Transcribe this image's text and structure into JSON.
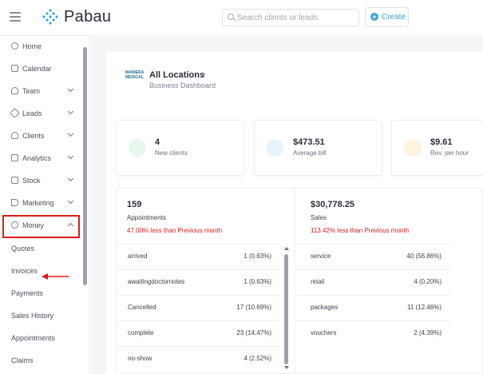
{
  "header": {
    "logo_text": "Pabau",
    "search_placeholder": "Search clients or leads",
    "create_label": "Create"
  },
  "sidebar": {
    "items": [
      {
        "label": "Home",
        "icon": "home-icon"
      },
      {
        "label": "Calendar",
        "icon": "calendar-icon"
      },
      {
        "label": "Team",
        "icon": "team-icon"
      },
      {
        "label": "Leads",
        "icon": "leads-icon"
      },
      {
        "label": "Clients",
        "icon": "clients-icon"
      },
      {
        "label": "Analytics",
        "icon": "analytics-icon"
      },
      {
        "label": "Stock",
        "icon": "stock-icon"
      },
      {
        "label": "Marketing",
        "icon": "marketing-icon"
      },
      {
        "label": "Money",
        "icon": "money-icon"
      }
    ],
    "money_sub": [
      "Quotes",
      "Invoices",
      "Payments",
      "Sales History",
      "Appointments",
      "Claims"
    ]
  },
  "dashboard": {
    "logo_text": "MANIERA MEDICAL",
    "location": "All Locations",
    "subtitle": "Business Dashboard",
    "stats": [
      {
        "value": "4",
        "label": "New clients"
      },
      {
        "value": "$473.51",
        "label": "Average bill"
      },
      {
        "value": "$9.61",
        "label": "Rev. per hour"
      }
    ],
    "appointments": {
      "value": "159",
      "label": "Appointments",
      "change": "47.00% less than Previous month",
      "rows": [
        {
          "name": "arrived",
          "value": "1 (0.63%)"
        },
        {
          "name": "awaitingdoctornotes",
          "value": "1 (0.63%)"
        },
        {
          "name": "Cancelled",
          "value": "17 (10.69%)"
        },
        {
          "name": "complete",
          "value": "23 (14.47%)"
        },
        {
          "name": "no-show",
          "value": "4 (2.52%)"
        }
      ]
    },
    "sales": {
      "value": "$30,778.25",
      "label": "Sales",
      "change": "113.42% less than Previous month",
      "rows": [
        {
          "name": "service",
          "value": "40 (56.86%)"
        },
        {
          "name": "retail",
          "value": "4 (0.20%)"
        },
        {
          "name": "packages",
          "value": "11 (12.46%)"
        },
        {
          "name": "vouchers",
          "value": "2 (4.39%)"
        }
      ]
    }
  },
  "colors": {
    "accent": "#3da6d9",
    "highlight": "#e01b1b",
    "bg": "#f4f5f7"
  }
}
